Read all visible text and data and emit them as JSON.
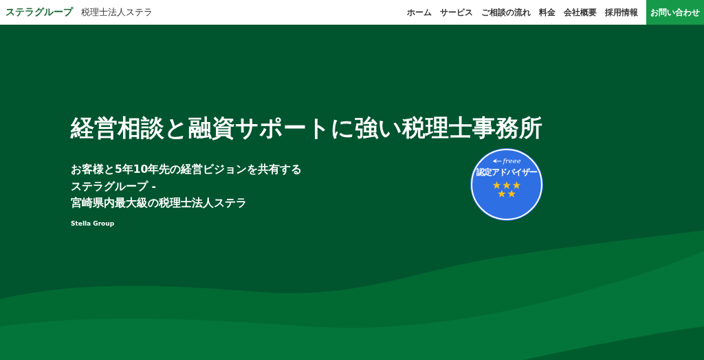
{
  "header": {
    "logo": "ステラグループ",
    "company": "税理士法人ステラ",
    "nav": [
      {
        "label": "ホーム",
        "kind": "link"
      },
      {
        "label": "サービス",
        "kind": "link"
      },
      {
        "label": "ご相談の流れ",
        "kind": "link"
      },
      {
        "label": "料金",
        "kind": "link"
      },
      {
        "label": "会社概要",
        "kind": "link"
      },
      {
        "label": "採用情報",
        "kind": "link"
      },
      {
        "label": "お問い合わせ",
        "kind": "cta"
      }
    ]
  },
  "hero": {
    "title": "経営相談と融資サポートに強い税理士事務所",
    "subtitle_lines": [
      "お客様と5年10年先の経営ビジョンを共有する",
      "ステラグループ -",
      "宮崎県内最大級の税理士法人ステラ"
    ],
    "caption": "Stella Group",
    "badge": {
      "brand": "freee",
      "label": "認定アドバイザー"
    }
  }
}
